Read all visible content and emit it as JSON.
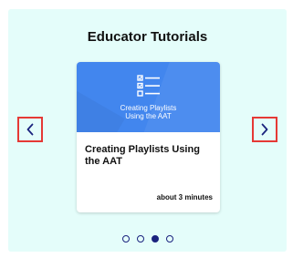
{
  "widget": {
    "title": "Educator Tutorials"
  },
  "card": {
    "thumbnail_text": "Creating Playlists\nUsing the AAT",
    "thumbnail_icon": "checklist-icon",
    "title": "Creating Playlists Using the AAT",
    "duration": "about 3 minutes"
  },
  "navigation": {
    "prev_icon": "chevron-left-icon",
    "next_icon": "chevron-right-icon"
  },
  "pagination": {
    "total": 4,
    "active_index": 2
  },
  "colors": {
    "panel_bg": "#e4fdfa",
    "thumbnail_bg": "#4286ee",
    "nav_border": "#e53935",
    "accent": "#1a237e"
  }
}
